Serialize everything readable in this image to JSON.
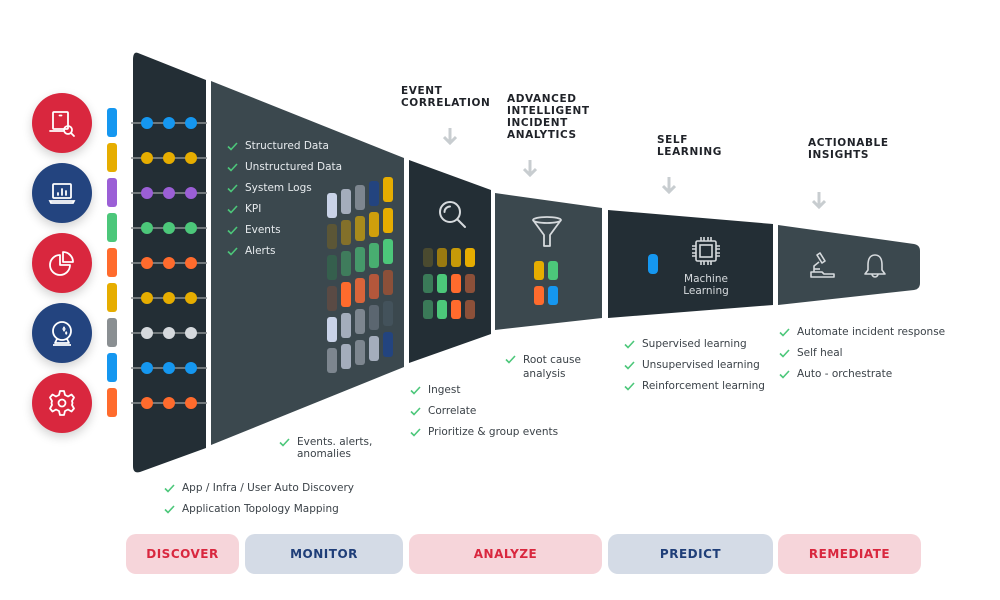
{
  "colors": {
    "panel_dark": "#232e35",
    "panel_mid": "#3b484e",
    "check_green": "#4cc77a",
    "red": "#d9273e",
    "navy": "#23447f",
    "pill_red_bg": "#f6d5da",
    "pill_blue_bg": "#d4dbe6",
    "arrow_gray": "#c8cdd0"
  },
  "left_icons": [
    {
      "name": "laptop-search-icon",
      "color": "#d9273e"
    },
    {
      "name": "laptop-chart-icon",
      "color": "#23447f"
    },
    {
      "name": "pie-chart-icon",
      "color": "#d9273e"
    },
    {
      "name": "crystal-ball-icon",
      "color": "#23447f"
    },
    {
      "name": "gear-icon",
      "color": "#d9273e"
    }
  ],
  "source_colors": [
    "#1597f0",
    "#e6ad00",
    "#9b5fd6",
    "#4cc77a",
    "#ff6b2d",
    "#e6ad00",
    "#d5d9dd",
    "#1597f0",
    "#ff6b2d"
  ],
  "source_bar_colors": [
    "#1597f0",
    "#e6ad00",
    "#9b5fd6",
    "#4cc77a",
    "#ff6b2d",
    "#e6ad00",
    "#8a8f92",
    "#1597f0",
    "#ff6b2d"
  ],
  "stage_titles": {
    "event_correlation": "EVENT\nCORRELATION",
    "advanced": "ADVANCED\nINTELLIGENT\nINCIDENT\nANALYTICS",
    "self_learning": "SELF\nLEARNING",
    "actionable": "ACTIONABLE\nINSIGHTS"
  },
  "monitor_inputs": [
    "Structured Data",
    "Unstructured Data",
    "System Logs",
    "KPI",
    "Events",
    "Alerts"
  ],
  "discover_features": [
    "App / Infra / User Auto Discovery",
    "Application Topology Mapping"
  ],
  "monitor_output": "Events. alerts,\nanomalies",
  "correlation_features": [
    "Ingest",
    "Correlate",
    "Prioritize & group events"
  ],
  "analytics_features": [
    "Root cause\nanalysis"
  ],
  "learning_features": [
    "Supervised learning",
    "Unsupervised learning",
    "Reinforcement learning"
  ],
  "remediate_features": [
    "Automate incident response",
    "Self heal",
    "Auto - orchestrate"
  ],
  "machine_learning_label": "Machine\nLearning",
  "panel_icons": {
    "correlation": "magnifier-icon",
    "analytics": "funnel-icon",
    "learning": "cpu-chip-icon",
    "remediate_1": "microscope-icon",
    "remediate_2": "bell-icon"
  },
  "monitor_grid_colors": [
    [
      "#c9d3e8",
      "#a4adbc",
      "#7d868f",
      "#23447f",
      "#e6ad00"
    ],
    [
      "#5b5636",
      "#83702a",
      "#a78a1c",
      "#cf9f0c",
      "#e6ad00"
    ],
    [
      "#355f4d",
      "#3f7c5c",
      "#45986a",
      "#48ae70",
      "#4cc77a"
    ],
    [
      "#5a4a44",
      "#ff6b2d",
      "#d9643a",
      "#b4573b",
      "#8c5039"
    ],
    [
      "#c9d3e8",
      "#a4adbc",
      "#7d868f",
      "#5b6670",
      "#43525b"
    ],
    [
      "#7d868f",
      "#a4adbc",
      "#7d868f",
      "#a4adbc",
      "#23447f"
    ]
  ],
  "correlation_grid_colors": [
    [
      "#4a4a2f",
      "#9a7a10",
      "#c79a08",
      "#e6ad00"
    ],
    [
      "#3a7a58",
      "#4cc77a",
      "#ff6b2d",
      "#8c5039"
    ],
    [
      "#3a7a58",
      "#4cc77a",
      "#ff6b2d",
      "#8c5039"
    ]
  ],
  "analytics_grid_colors": [
    [
      "#e6ad00",
      "#4cc77a"
    ],
    [
      "#ff6b2d",
      "#1597f0"
    ]
  ],
  "learning_dot_color": "#1597f0",
  "phases": [
    {
      "label": "DISCOVER",
      "style": "red"
    },
    {
      "label": "MONITOR",
      "style": "blue"
    },
    {
      "label": "ANALYZE",
      "style": "red"
    },
    {
      "label": "PREDICT",
      "style": "blue"
    },
    {
      "label": "REMEDIATE",
      "style": "red"
    }
  ]
}
